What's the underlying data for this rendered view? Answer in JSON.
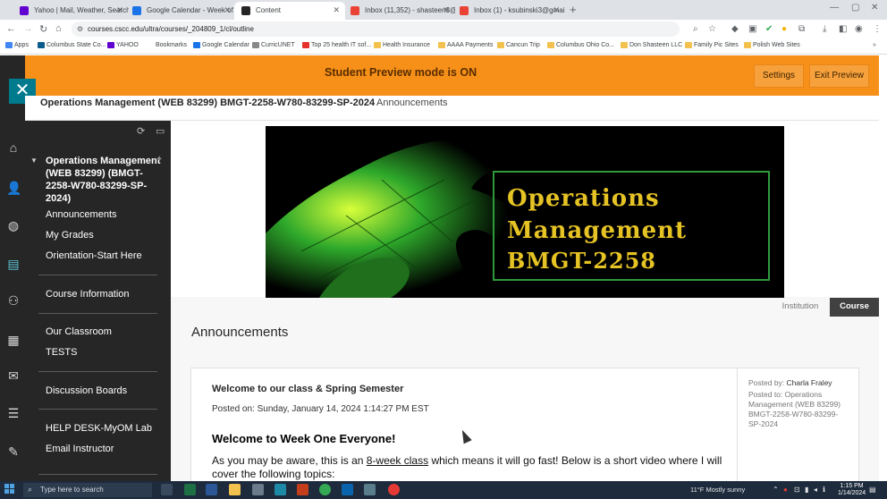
{
  "browser": {
    "tabs": [
      {
        "label": "Yahoo | Mail, Weather, Search",
        "color": "#6001d2"
      },
      {
        "label": "Google Calendar - Week of Jan",
        "color": "#1a73e8"
      },
      {
        "label": "Content",
        "color": "#262626"
      },
      {
        "label": "Inbox (11,352) - shasteen3@g",
        "color": "#ea4335"
      },
      {
        "label": "Inbox (1) - ksubinski3@gmail",
        "color": "#ea4335"
      }
    ],
    "url": "courses.cscc.edu/ultra/courses/_204809_1/cl/outline",
    "bookmarks": [
      "Apps",
      "Columbus State Co...",
      "YAHOO",
      "Bookmarks",
      "Google Calendar",
      "CurricUNET",
      "Top 25 health IT sof...",
      "Health Insurance",
      "AAAA Payments",
      "Cancun Trip",
      "Columbus Ohio Co...",
      "Don Shasteen LLC",
      "Family Pic Sites",
      "Polish Web Sites"
    ]
  },
  "preview": {
    "message": "Student Preview mode is ON",
    "settings_label": "Settings",
    "exit_label": "Exit Preview",
    "bg_color": "#f69018"
  },
  "course": {
    "title": "Operations Management (WEB 83299) BMGT-2258-W780-83299-SP-2024",
    "breadcrumb": "Announcements",
    "nav_title": "Operations Management (WEB 83299) (BMGT-2258-W780-83299-SP-2024)"
  },
  "nav": {
    "items": [
      {
        "label": "Announcements"
      },
      {
        "label": "My Grades"
      },
      {
        "label": "Orientation-Start Here"
      },
      {
        "label": "Course Information"
      },
      {
        "label": "Our Classroom"
      },
      {
        "label": "TESTS"
      },
      {
        "label": "Discussion Boards"
      },
      {
        "label": "HELP DESK-MyOM Lab"
      },
      {
        "label": "Email Instructor"
      }
    ]
  },
  "banner": {
    "line1": "Operations",
    "line2": "Management",
    "line3": "BMGT-2258"
  },
  "tabs": {
    "institution": "Institution",
    "course": "Course"
  },
  "announcements": {
    "heading": "Announcements",
    "item": {
      "title": "Welcome to our class & Spring Semester",
      "posted_on": "Posted on: Sunday, January 14, 2024 1:14:27 PM EST",
      "subheading": "Welcome to Week One Everyone!",
      "body_part1": "As you may be aware, this is an ",
      "body_link": "8-week class",
      "body_part2": " which means it will go fast!  Below is a short video where I will cover the following topics:",
      "posted_by_label": "Posted by: ",
      "posted_by": "Charla Fraley",
      "posted_to_label": "Posted to: ",
      "posted_to": "Operations Management (WEB 83299) BMGT-2258-W780-83299-SP-2024"
    }
  },
  "taskbar": {
    "search_placeholder": "Type here to search",
    "weather": "11°F  Mostly sunny",
    "time": "1:15 PM",
    "date": "1/14/2024"
  }
}
